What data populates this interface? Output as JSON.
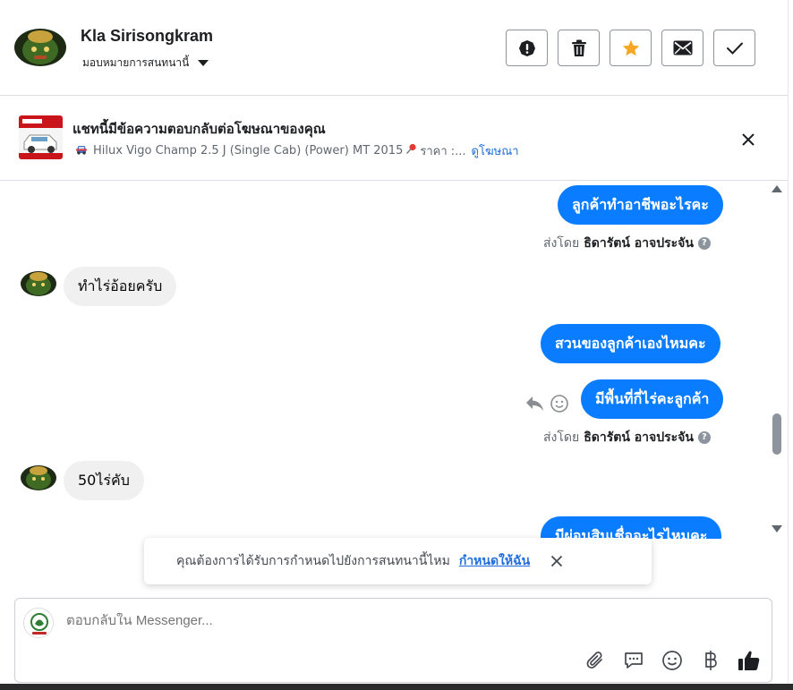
{
  "header": {
    "contact_name": "Kla Sirisongkram",
    "assign_label": "มอบหมายการสนทนานี้",
    "actions": [
      {
        "name": "report-button",
        "icon": "exclamation-circle-icon"
      },
      {
        "name": "delete-button",
        "icon": "trash-icon"
      },
      {
        "name": "star-button",
        "icon": "star-icon"
      },
      {
        "name": "mark-unread-button",
        "icon": "envelope-icon"
      },
      {
        "name": "mark-done-button",
        "icon": "checkmark-icon"
      }
    ]
  },
  "ad_banner": {
    "title": "แชทนี้มีข้อความตอบกลับต่อโฆษณาของคุณ",
    "description": "Hilux Vigo Champ 2.5 J (Single Cab) (Power) MT 2015",
    "price_label": "ราคา :...",
    "view_ad_link": "ดูโฆษณา"
  },
  "messages": [
    {
      "direction": "out",
      "text": "ลูกค้าทำอาชีพอะไรคะ"
    },
    {
      "type": "sent_by",
      "prefix": "ส่งโดย",
      "agent": "ธิดารัตน์ อาจประจัน"
    },
    {
      "direction": "in",
      "text": "ทำไร่อ้อยครับ"
    },
    {
      "direction": "out",
      "text": "สวนของลูกค้าเองไหมคะ"
    },
    {
      "direction": "out",
      "text": "มีพื้นที่กี่ไร่คะลูกค้า"
    },
    {
      "type": "sent_by",
      "prefix": "ส่งโดย",
      "agent": "ธิดารัตน์ อาจประจัน"
    },
    {
      "direction": "in",
      "text": "50ไร่คับ"
    },
    {
      "direction": "out",
      "text": "มีผ่อนสินเชื่ออะไรไหมคะ"
    }
  ],
  "toast": {
    "text": "คุณต้องการได้รับการกำหนดไปยังการสนทนานี้ไหม",
    "link": "กำหนดให้ฉัน"
  },
  "composer": {
    "placeholder": "ตอบกลับใน Messenger..."
  },
  "colors": {
    "outgoing_bubble": "#0a7cff",
    "incoming_bubble": "#f0f0f0",
    "link": "#216fdb",
    "star": "#f5a623"
  }
}
